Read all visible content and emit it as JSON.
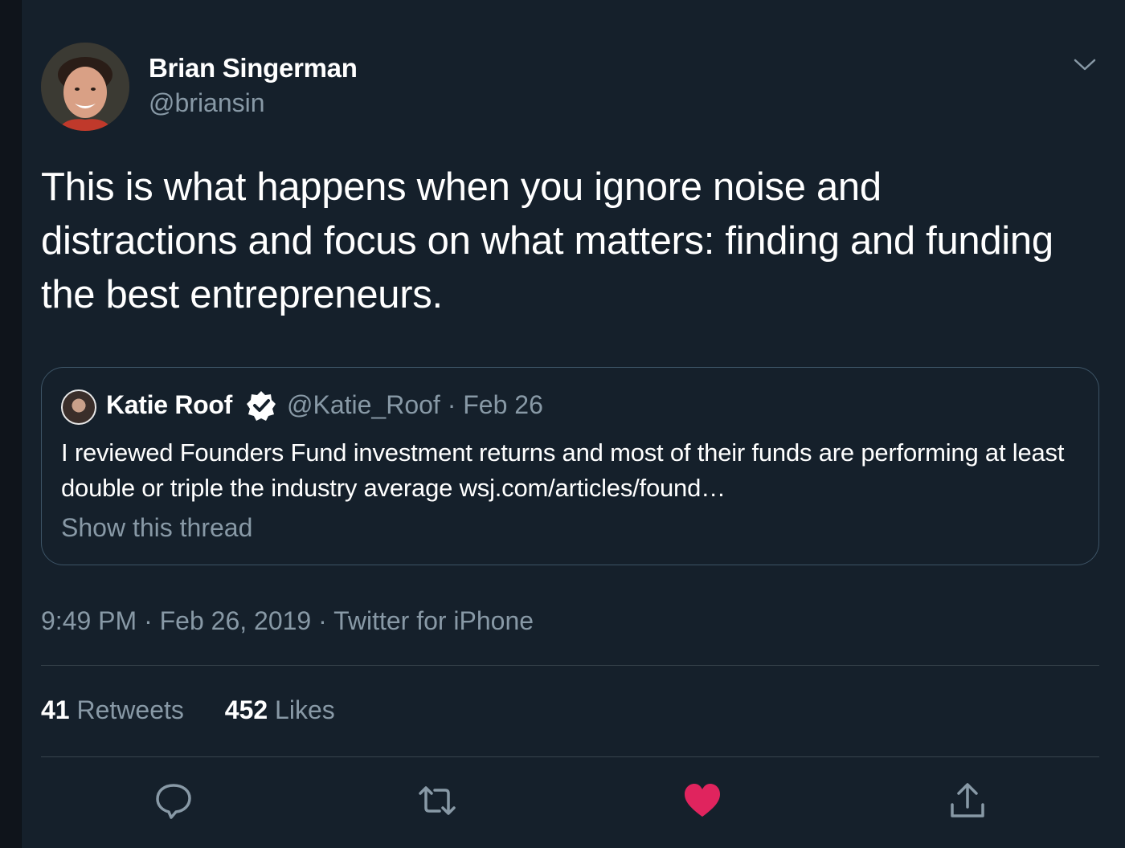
{
  "author": {
    "name": "Brian Singerman",
    "handle": "@briansin"
  },
  "tweet": {
    "text": "This is what happens when you ignore noise and distractions and focus on what matters: finding and funding the best entrepreneurs.",
    "timestamp": "9:49 PM · Feb 26, 2019 · Twitter for iPhone"
  },
  "quoted": {
    "name": "Katie Roof",
    "handle": "@Katie_Roof",
    "separator": "·",
    "date": "Feb 26",
    "text": "I reviewed Founders Fund investment returns and most of their funds are performing at least double or triple the industry average wsj.com/articles/found…",
    "show_thread": "Show this thread"
  },
  "stats": {
    "retweets_count": "41",
    "retweets_label": "Retweets",
    "likes_count": "452",
    "likes_label": "Likes"
  },
  "actions": {
    "icons": [
      "reply-icon",
      "retweet-icon",
      "like-icon",
      "share-icon"
    ],
    "liked": true
  },
  "colors": {
    "background": "#15202b",
    "secondary_text": "#8899a6",
    "like": "#e0245e",
    "border": "#38444d"
  }
}
